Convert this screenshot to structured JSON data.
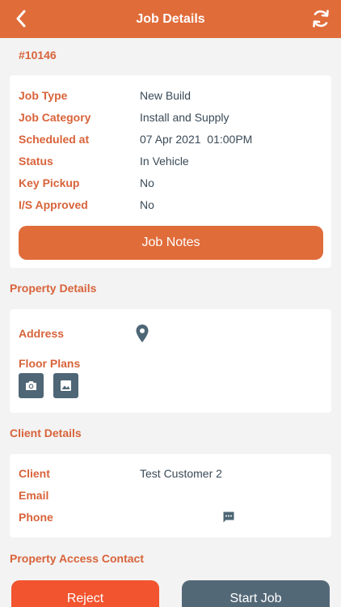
{
  "header": {
    "title": "Job Details",
    "back_icon": "chevron-left-icon",
    "refresh_icon": "refresh-icon"
  },
  "job": {
    "number": "#10146",
    "fields": [
      {
        "label": "Job Type",
        "value": "New Build"
      },
      {
        "label": "Job Category",
        "value": "Install and Supply"
      },
      {
        "label": "Scheduled at",
        "value": "07 Apr 2021  01:00PM"
      },
      {
        "label": "Status",
        "value": "In Vehicle"
      },
      {
        "label": "Key Pickup",
        "value": "No"
      },
      {
        "label": "I/S Approved",
        "value": "No"
      }
    ],
    "notes_button": "Job Notes"
  },
  "property": {
    "section_title": "Property Details",
    "address_label": "Address",
    "floor_plans_label": "Floor Plans"
  },
  "client": {
    "section_title": "Client Details",
    "client_label": "Client",
    "client_value": "Test Customer 2",
    "email_label": "Email",
    "phone_label": "Phone"
  },
  "access": {
    "section_title": "Property Access Contact"
  },
  "actions": {
    "reject": "Reject",
    "start": "Start Job"
  },
  "colors": {
    "accent": "#e06c3a",
    "reject": "#f1542f",
    "secondary": "#536877"
  }
}
